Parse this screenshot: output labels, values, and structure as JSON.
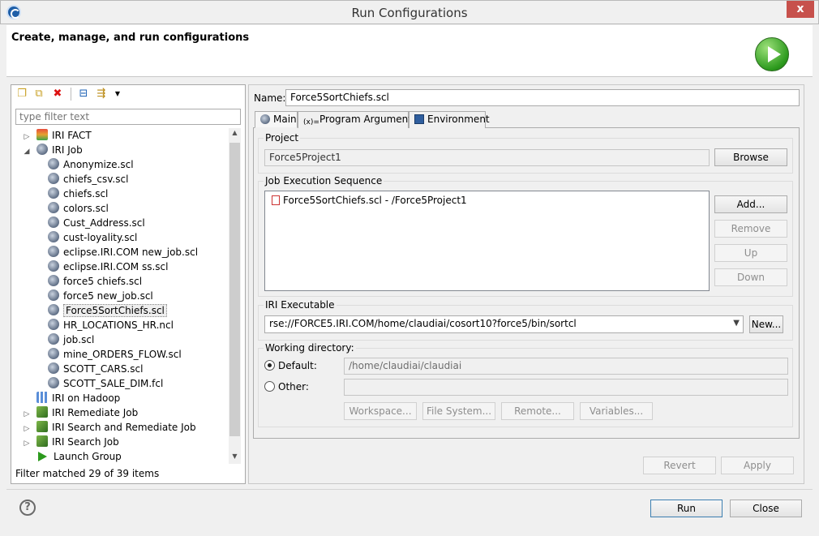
{
  "window": {
    "title": "Run Configurations",
    "close_glyph": "x"
  },
  "header": {
    "text": "Create, manage, and run configurations",
    "icon": "run-icon"
  },
  "left": {
    "toolbar_icons": [
      "new-config-icon",
      "duplicate-icon",
      "delete-icon",
      "collapse-all-icon",
      "filter-icon",
      "dropdown-icon"
    ],
    "filter_placeholder": "type filter text",
    "tree": [
      {
        "label": "IRI FACT",
        "level": 0,
        "expand": "collapsed",
        "icon": "fact"
      },
      {
        "label": "IRI Job",
        "level": 0,
        "expand": "expanded",
        "icon": "job"
      },
      {
        "label": "Anonymize.scl",
        "level": 1,
        "icon": "job"
      },
      {
        "label": "chiefs_csv.scl",
        "level": 1,
        "icon": "job"
      },
      {
        "label": "chiefs.scl",
        "level": 1,
        "icon": "job"
      },
      {
        "label": "colors.scl",
        "level": 1,
        "icon": "job"
      },
      {
        "label": "Cust_Address.scl",
        "level": 1,
        "icon": "job"
      },
      {
        "label": "cust-loyality.scl",
        "level": 1,
        "icon": "job"
      },
      {
        "label": "eclipse.IRI.COM new_job.scl",
        "level": 1,
        "icon": "job"
      },
      {
        "label": "eclipse.IRI.COM ss.scl",
        "level": 1,
        "icon": "job"
      },
      {
        "label": "force5 chiefs.scl",
        "level": 1,
        "icon": "job"
      },
      {
        "label": "force5 new_job.scl",
        "level": 1,
        "icon": "job"
      },
      {
        "label": "Force5SortChiefs.scl",
        "level": 1,
        "icon": "job",
        "selected": true
      },
      {
        "label": "HR_LOCATIONS_HR.ncl",
        "level": 1,
        "icon": "job"
      },
      {
        "label": "job.scl",
        "level": 1,
        "icon": "job"
      },
      {
        "label": "mine_ORDERS_FLOW.scl",
        "level": 1,
        "icon": "job"
      },
      {
        "label": "SCOTT_CARS.scl",
        "level": 1,
        "icon": "job"
      },
      {
        "label": "SCOTT_SALE_DIM.fcl",
        "level": 1,
        "icon": "job"
      },
      {
        "label": "IRI on Hadoop",
        "level": 0,
        "expand": "none",
        "icon": "hadoop"
      },
      {
        "label": "IRI Remediate Job",
        "level": 0,
        "expand": "collapsed",
        "icon": "remed"
      },
      {
        "label": "IRI Search and Remediate Job",
        "level": 0,
        "expand": "collapsed",
        "icon": "remed"
      },
      {
        "label": "IRI Search Job",
        "level": 0,
        "expand": "collapsed",
        "icon": "remed"
      },
      {
        "label": "Launch Group",
        "level": 0,
        "expand": "none",
        "icon": "launch"
      }
    ],
    "status": "Filter matched 29 of 39 items"
  },
  "right": {
    "name_label": "Name:",
    "name_value": "Force5SortChiefs.scl",
    "tabs": [
      {
        "label": "Main",
        "active": true,
        "icon": "main-tab-icon"
      },
      {
        "label": "Program Arguments",
        "active": false,
        "icon": "arguments-icon"
      },
      {
        "label": "Environment",
        "active": false,
        "icon": "environment-icon"
      }
    ],
    "project": {
      "label": "Project",
      "value": "Force5Project1",
      "browse": "Browse"
    },
    "sequence": {
      "label": "Job Execution Sequence",
      "items": [
        "Force5SortChiefs.scl - /Force5Project1"
      ],
      "add": "Add...",
      "remove": "Remove",
      "up": "Up",
      "down": "Down"
    },
    "executable": {
      "label": "IRI Executable",
      "value": "rse://FORCE5.IRI.COM/home/claudiai/cosort10?force5/bin/sortcl",
      "new": "New..."
    },
    "workdir": {
      "label": "Working directory:",
      "default_label": "Default:",
      "default_value": "/home/claudiai/claudiai",
      "other_label": "Other:",
      "other_value": "",
      "selected": "default",
      "workspace": "Workspace...",
      "filesystem": "File System...",
      "remote": "Remote...",
      "variables": "Variables..."
    },
    "revert": "Revert",
    "apply": "Apply"
  },
  "footer": {
    "help_glyph": "?",
    "run": "Run",
    "close": "Close"
  },
  "colors": {
    "run_green": "#2c9a1d",
    "close_red": "#c7514c",
    "default_button_border": "#3c7fb1"
  }
}
